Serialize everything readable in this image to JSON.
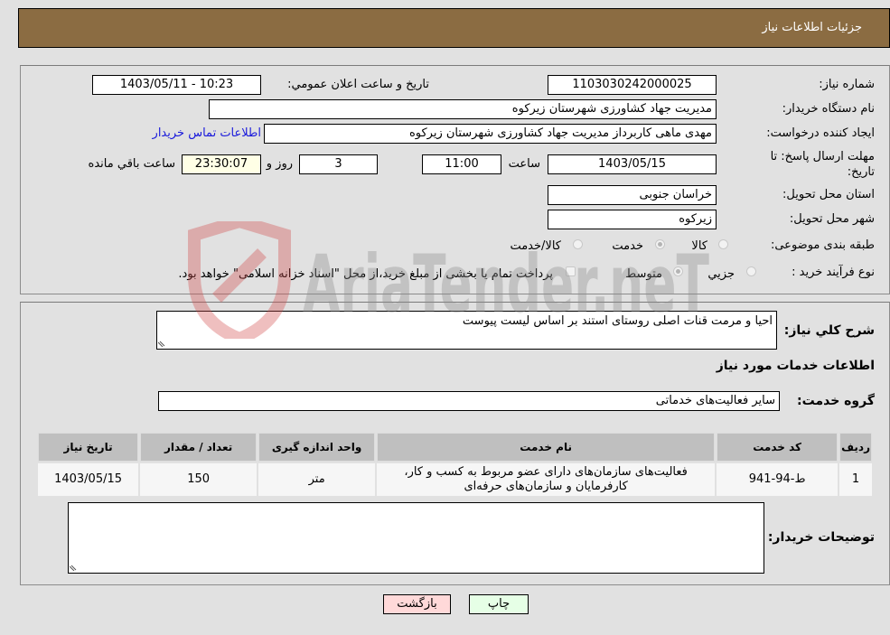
{
  "header": {
    "title": "جزئیات اطلاعات نیاز"
  },
  "details": {
    "need_number": {
      "label": "شماره نیاز:",
      "value": "1103030242000025"
    },
    "announce_datetime": {
      "label": "تاریخ و ساعت اعلان عمومي:",
      "value": "1403/05/11 - 10:23"
    },
    "buyer_org": {
      "label": "نام دستگاه خریدار:",
      "value": "مدیریت جهاد کشاورزی شهرستان زیرکوه"
    },
    "requester": {
      "label": "ایجاد کننده درخواست:",
      "value": "مهدی ماهی کاربرداز مدیریت جهاد کشاورزی شهرستان زیرکوه"
    },
    "buyer_contact_link": "اطلاعات تماس خریدار",
    "deadline": {
      "label_line1": "مهلت ارسال پاسخ: تا",
      "label_line2": "تاریخ:",
      "date": "1403/05/15",
      "time_label": "ساعت",
      "time": "11:00",
      "days": "3",
      "days_label": "روز و",
      "remaining": "23:30:07",
      "remaining_label": "ساعت باقي مانده"
    },
    "delivery_province": {
      "label": "استان محل تحویل:",
      "value": "خراسان جنوبی"
    },
    "delivery_city": {
      "label": "شهر محل تحویل:",
      "value": "زیرکوه"
    },
    "category": {
      "label": "طبقه بندی موضوعی:",
      "options": [
        "کالا",
        "خدمت",
        "کالا/خدمت"
      ],
      "selected": "خدمت"
    },
    "purchase_type": {
      "label": "نوع فرآیند خرید :",
      "options": [
        "جزيي",
        "متوسط"
      ],
      "selected": "متوسط",
      "treasury_checkbox_label": "پرداخت تمام یا بخشی از مبلغ خرید،از محل \"اسناد خزانه اسلامی\" خواهد بود.",
      "treasury_checked": false
    }
  },
  "description": {
    "label": "شرح کلي نیاز:",
    "value": "احیا و مرمت قنات اصلی روستای استند بر اساس لیست پیوست"
  },
  "services": {
    "section_title": "اطلاعات خدمات مورد نیاز",
    "group_label": "گروه خدمت:",
    "group_value": "سایر فعالیت‌های خدماتی",
    "table": {
      "headers": [
        "ردیف",
        "کد خدمت",
        "نام خدمت",
        "واحد اندازه گیری",
        "تعداد / مقدار",
        "تاریخ نیاز"
      ],
      "rows": [
        {
          "row": "1",
          "code": "ط-94-941",
          "name_line1": "فعالیت‌های سازمان‌های دارای عضو مربوط به کسب و کار،",
          "name_line2": "کارفرمایان و سازمان‌های حرفه‌ای",
          "unit": "متر",
          "quantity": "150",
          "date": "1403/05/15"
        }
      ]
    }
  },
  "buyer_notes": {
    "label": "توضیحات خریدار:",
    "value": ""
  },
  "buttons": {
    "print": "چاپ",
    "back": "بازگشت"
  },
  "watermark": {
    "text": "AriaTender.neT"
  }
}
